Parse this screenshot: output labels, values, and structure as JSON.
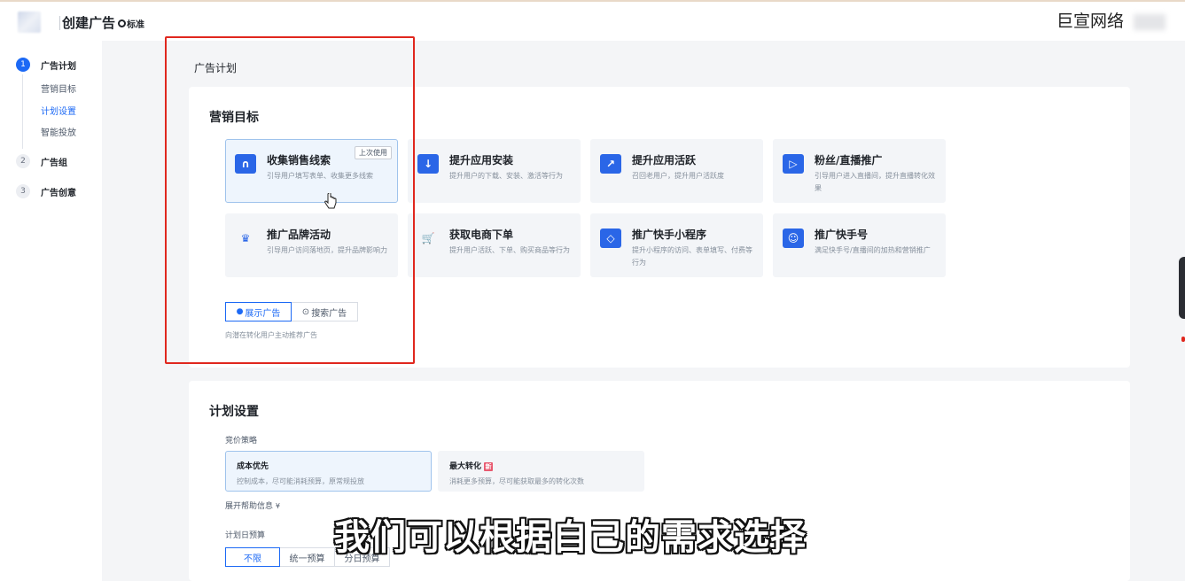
{
  "app": {
    "title": "创建广告",
    "badge": "标准",
    "watermark": "巨宣网络"
  },
  "sidebar": {
    "steps": [
      {
        "number": "1",
        "label": "广告计划",
        "active": true
      },
      {
        "number": "2",
        "label": "广告组",
        "active": false
      },
      {
        "number": "3",
        "label": "广告创意",
        "active": false
      }
    ],
    "sub_items": [
      {
        "label": "营销目标",
        "active": false
      },
      {
        "label": "计划设置",
        "active": true
      },
      {
        "label": "智能投放",
        "active": false
      }
    ]
  },
  "main": {
    "section_heading": "广告计划",
    "marketing": {
      "title": "营销目标",
      "goals": [
        {
          "name": "收集销售线索",
          "desc": "引导用户填写表单、收集更多线索",
          "tag": "上次使用",
          "icon": "form-icon",
          "selected": true
        },
        {
          "name": "提升应用安装",
          "desc": "提升用户的下载、安装、激活等行为",
          "icon": "download-icon"
        },
        {
          "name": "提升应用活跃",
          "desc": "召回老用户，提升用户活跃度",
          "icon": "trend-icon"
        },
        {
          "name": "粉丝/直播推广",
          "desc": "引导用户进入直播间，提升直播转化效果",
          "icon": "video-icon"
        },
        {
          "name": "推广品牌活动",
          "desc": "引导用户访问落地页，提升品牌影响力",
          "icon": "crown-icon"
        },
        {
          "name": "获取电商下单",
          "desc": "提升用户活跃、下单、购买商品等行为",
          "icon": "cart-icon"
        },
        {
          "name": "推广快手小程序",
          "desc": "提升小程序的访问、表单填写、付费等行为",
          "icon": "mini-program-icon"
        },
        {
          "name": "推广快手号",
          "desc": "满足快手号/直播间的加热和营销推广",
          "icon": "account-icon"
        }
      ],
      "ad_type_tabs": [
        "展示广告",
        "搜索广告"
      ],
      "hint": "向潜在转化用户主动推荐广告"
    },
    "plan": {
      "title": "计划设置",
      "bid_label": "竞价策略",
      "bid_options": [
        {
          "name": "成本优先",
          "desc": "控制成本，尽可能消耗预算，原常规投放",
          "selected": true
        },
        {
          "name": "最大转化",
          "desc": "消耗更多预算，尽可能获取最多的转化次数",
          "new_tag": "新"
        }
      ],
      "expand_help": "展开帮助信息",
      "budget_label": "计划日预算",
      "budget_tabs": [
        "不限",
        "统一预算",
        "分日预算"
      ]
    }
  },
  "subtitle": "我们可以根据自己的需求选择"
}
